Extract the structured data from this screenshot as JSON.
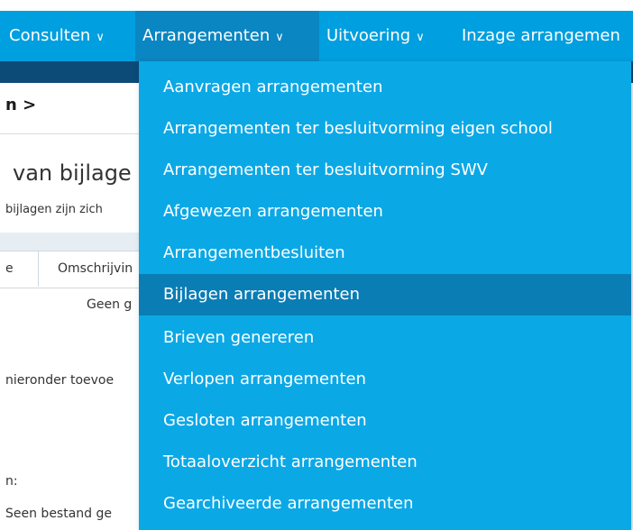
{
  "nav": {
    "items": [
      {
        "label": "Consulten",
        "chevron": "∨"
      },
      {
        "label": "Arrangementen",
        "chevron": "∨"
      },
      {
        "label": "Uitvoering",
        "chevron": "∨"
      },
      {
        "label": "Inzage arrangemen",
        "chevron": ""
      }
    ]
  },
  "page": {
    "breadcrumb": "n >",
    "title": "van bijlage",
    "subtitle": "bijlagen zijn zich",
    "table": {
      "col1": "e",
      "col2": "Omschrijvin",
      "empty": "Geen g"
    },
    "line1": "nieronder toevoe",
    "line2": "n:",
    "line3": "Seen bestand ge"
  },
  "dropdown": {
    "items": [
      "Aanvragen arrangementen",
      "Arrangementen ter besluitvorming eigen school",
      "Arrangementen ter besluitvorming SWV",
      "Afgewezen arrangementen",
      "Arrangementbesluiten",
      "Bijlagen arrangementen",
      "Brieven genereren",
      "Verlopen arrangementen",
      "Gesloten arrangementen",
      "Totaaloverzicht arrangementen",
      "Gearchiveerde arrangementen"
    ],
    "selected_index": 5
  },
  "colors": {
    "navbar": "#009fdf",
    "dropdown": "#0ba8e6",
    "selected": "#0a7db5"
  }
}
